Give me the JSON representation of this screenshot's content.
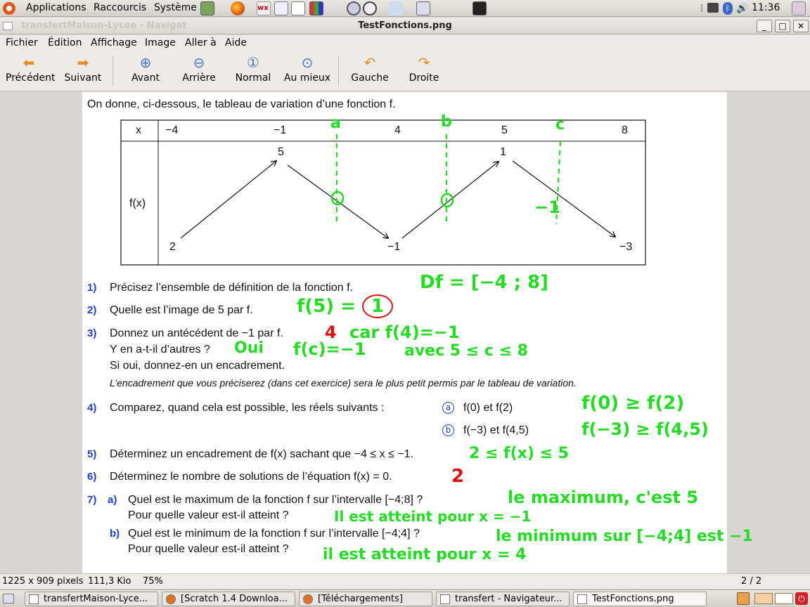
{
  "system_bar": {
    "menus": [
      "Applications",
      "Raccourcis",
      "Système"
    ],
    "clock": "11:36"
  },
  "window": {
    "title": "TestFonctions.png",
    "background_title": "transfertMaison-Lycee - Navigat",
    "controls": {
      "minimize": "_",
      "maximize": "□",
      "close": "✕"
    }
  },
  "menubar": [
    "Fichier",
    "Édition",
    "Affichage",
    "Image",
    "Aller à",
    "Aide"
  ],
  "toolbar": {
    "previous": "Précédent",
    "next": "Suivant",
    "zoom_in": "Avant",
    "zoom_out": "Arrière",
    "normal": "Normal",
    "best_fit": "Au mieux",
    "rotate_left": "Gauche",
    "rotate_right": "Droite"
  },
  "document": {
    "intro": "On donne, ci-dessous, le tableau de variation d’une fonction f.",
    "table": {
      "x_header": "x",
      "fx_header": "f(x)",
      "x_values": [
        "−4",
        "−1",
        "4",
        "5",
        "8"
      ],
      "fx_values": {
        "v_a": "2",
        "v_b": "5",
        "v_c": "−1",
        "v_d": "1",
        "v_e": "−3"
      }
    },
    "questions": {
      "q1": {
        "num": "1)",
        "text": "Précisez l’ensemble de définition de la fonction f."
      },
      "q2": {
        "num": "2)",
        "text": "Quelle est l’image de 5 par f."
      },
      "q3": {
        "num": "3)",
        "text": "Donnez un antécédent de −1 par f.",
        "sub1": "Y en a-t-il d’autres ?",
        "sub2": "Si oui, donnez-en un encadrement.",
        "note": "L’encadrement que vous préciserez (dans cet exercice) sera le plus petit permis par le tableau de variation."
      },
      "q4": {
        "num": "4)",
        "text": "Comparez, quand cela est possible, les réels suivants :",
        "a_label": "a",
        "a_text": "f(0)  et f(2)",
        "b_label": "b",
        "b_text": "f(−3)  et f(4,5)"
      },
      "q5": {
        "num": "5)",
        "text": "Déterminez un encadrement de f(x) sachant que −4 ≤ x ≤ −1."
      },
      "q6": {
        "num": "6)",
        "text": "Déterminez le nombre de solutions de l’équation f(x) = 0."
      },
      "q7": {
        "num": "7)",
        "a_label": "a)",
        "a_text": "Quel est le maximum de la fonction f sur l’intervalle [−4;8] ?",
        "a_sub": "Pour quelle valeur est-il atteint ?",
        "b_label": "b)",
        "b_text": "Quel est le minimum de la fonction f sur l’intervalle [−4;4] ?",
        "b_sub": "Pour quelle valeur est-il atteint ?"
      }
    },
    "handwriting": {
      "label_a": "a",
      "label_b": "b",
      "label_c": "c",
      "zero1": "0",
      "zero2": "0",
      "minus1": "−1",
      "h1": "Df = [−4 ; 8]",
      "h2": "f(5) = ",
      "h2_circled": "1",
      "h3_red": "4",
      "h3": "car f(4)=−1",
      "h3_oui": "Oui",
      "h3_fc": "f(c)=−1",
      "h3_avec": "avec  5 ≤ c ≤ 8",
      "h4a": "f(0) ≥ f(2)",
      "h4b": "f(−3) ≥ f(4,5)",
      "h5": "2 ≤ f(x) ≤ 5",
      "h6_red": "2",
      "h7a": "le maximum, c'est 5",
      "h7a2": "Il est atteint pour  x = −1",
      "h7b": "le minimum sur [−4;4] est −1",
      "h7b2": "il est atteint pour  x = 4"
    }
  },
  "statusbar": {
    "dimensions": "1225 x 909 pixels",
    "size": "111,3 Kio",
    "zoom": "75%",
    "page": "2 / 2"
  },
  "taskbar": [
    "transfertMaison-Lyce...",
    "[Scratch 1.4 Downloa...",
    "[Téléchargements]",
    "transfert - Navigateur...",
    "TestFonctions.png"
  ]
}
